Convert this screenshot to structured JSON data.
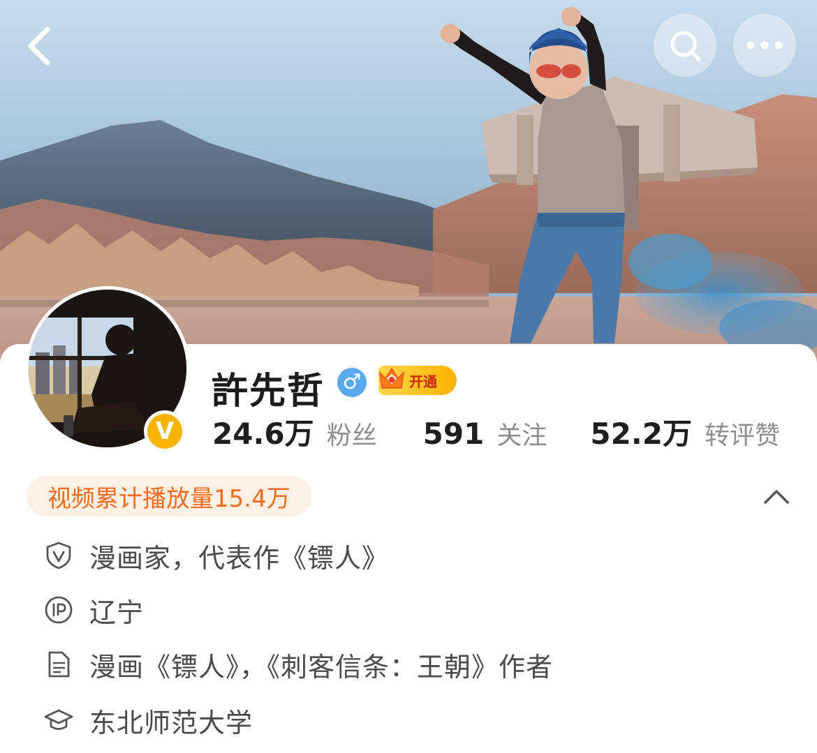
{
  "header": {
    "back_icon": "chevron-left-icon",
    "search_icon": "search-icon",
    "more_icon": "more-horizontal-icon"
  },
  "profile": {
    "name": "許先哲",
    "gender_symbol": "♂",
    "gender_icon": "male-icon",
    "verified_badge": "V",
    "vip_label": "开通",
    "stats": [
      {
        "value": "24.6万",
        "label": "粉丝"
      },
      {
        "value": "591",
        "label": "关注"
      },
      {
        "value": "52.2万",
        "label": "转评赞"
      }
    ],
    "play_count": "视频累计播放量15.4万"
  },
  "info": [
    {
      "icon": "verified-shield-icon",
      "text": "漫画家，代表作《镖人》"
    },
    {
      "icon": "ip-location-icon",
      "text": "辽宁"
    },
    {
      "icon": "document-icon",
      "text": "漫画《镖人》，《刺客信条：王朝》作者"
    },
    {
      "icon": "graduation-cap-icon",
      "text": "东北师范大学"
    }
  ],
  "colors": {
    "accent_orange": "#f26b1d",
    "pill_bg": "#fdf1e6",
    "verified_gold": "#f6b400",
    "gender_blue": "#5aa9ef",
    "muted_text": "#8e8e8e"
  }
}
